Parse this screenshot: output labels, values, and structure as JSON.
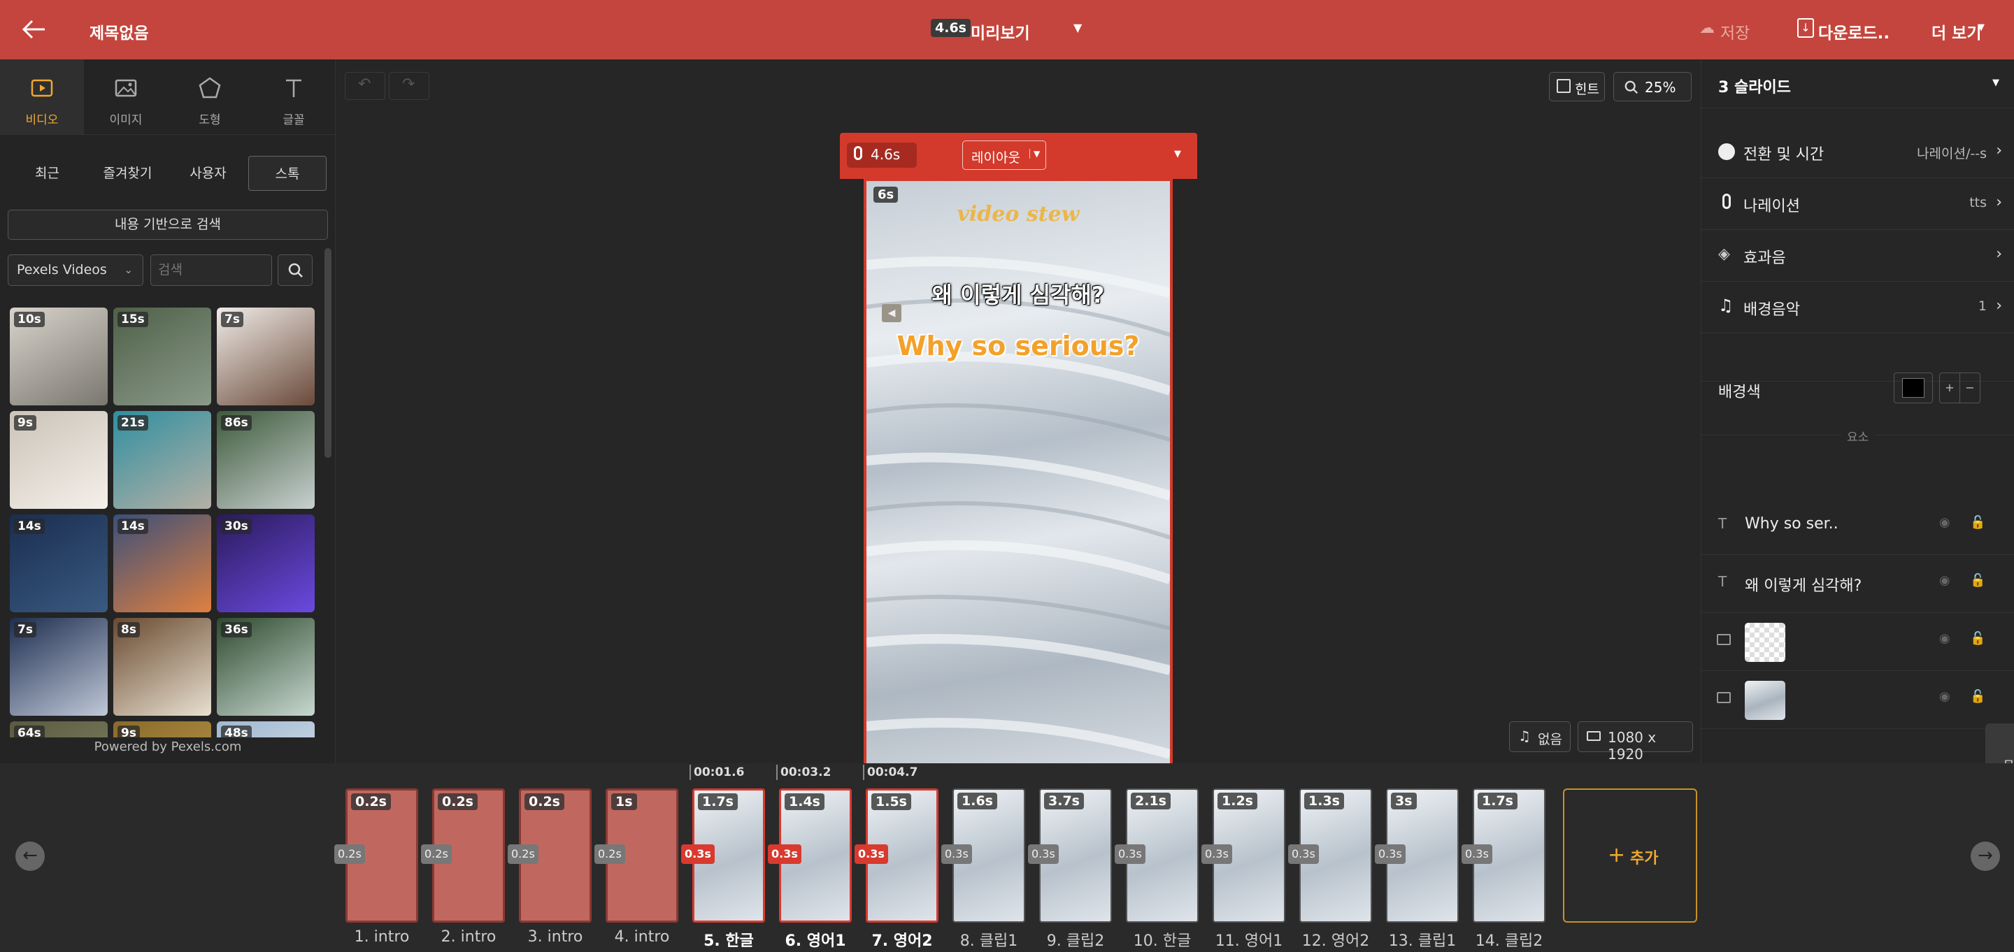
{
  "topbar": {
    "title": "제목없음",
    "preview_duration": "4.6s",
    "preview_label": "미리보기",
    "save": "저장",
    "download": "다운로드..",
    "more": "더 보기"
  },
  "media_tabs": [
    {
      "label": "비디오"
    },
    {
      "label": "이미지"
    },
    {
      "label": "도형"
    },
    {
      "label": "글꼴"
    }
  ],
  "source_tabs": [
    {
      "label": "최근"
    },
    {
      "label": "즐겨찾기"
    },
    {
      "label": "사용자"
    },
    {
      "label": "스톡"
    }
  ],
  "content_search_button": "내용 기반으로 검색",
  "provider_select": "Pexels Videos",
  "search": {
    "placeholder": "검색"
  },
  "stock_videos": [
    {
      "duration": "10s",
      "colors": [
        "#d8d4cc",
        "#7a7770"
      ]
    },
    {
      "duration": "15s",
      "colors": [
        "#4f6048",
        "#8a9a8a"
      ]
    },
    {
      "duration": "7s",
      "colors": [
        "#f0ece8",
        "#6a4a3a"
      ]
    },
    {
      "duration": "9s",
      "colors": [
        "#ccc3b8",
        "#f4f0ea"
      ]
    },
    {
      "duration": "21s",
      "colors": [
        "#2f8fa0",
        "#b5b0a5"
      ]
    },
    {
      "duration": "86s",
      "colors": [
        "#3e5a3a",
        "#c8d0d0"
      ]
    },
    {
      "duration": "14s",
      "colors": [
        "#1a2d50",
        "#3a5a80"
      ]
    },
    {
      "duration": "14s",
      "colors": [
        "#3b4f7a",
        "#e08040"
      ]
    },
    {
      "duration": "30s",
      "colors": [
        "#2a1a5a",
        "#6a4ae0"
      ]
    },
    {
      "duration": "7s",
      "colors": [
        "#1e2e50",
        "#c0c8d8"
      ]
    },
    {
      "duration": "8s",
      "colors": [
        "#6a4a30",
        "#e8e0d0"
      ]
    },
    {
      "duration": "36s",
      "colors": [
        "#2e4a2e",
        "#c8d8d0"
      ]
    },
    {
      "duration": "64s",
      "colors": [
        "#5a5a40",
        "#8a8a6a"
      ]
    },
    {
      "duration": "9s",
      "colors": [
        "#8a6a2a",
        "#c0a050"
      ]
    },
    {
      "duration": "48s",
      "colors": [
        "#a0b8d0",
        "#e0e8f0"
      ]
    }
  ],
  "powered_by": "Powered by Pexels.com",
  "canvas_toolbar": {
    "hint": "힌트",
    "zoom": "25%"
  },
  "slide_header": {
    "narration_duration": "4.6s",
    "layout_button": "레이아웃"
  },
  "canvas": {
    "timer": "6s",
    "watermark": "video stew",
    "korean_text": "왜 이렇게 심각해?",
    "english_text": "Why so serious?"
  },
  "canvas_footer": {
    "music": "없음",
    "resolution": "1080 x 1920"
  },
  "right_panel": {
    "slide_title": "3 슬라이드",
    "rows": [
      {
        "label": "전환 및 시간",
        "value": "나레이션/--s"
      },
      {
        "label": "나레이션",
        "value": "tts"
      },
      {
        "label": "효과음",
        "value": ""
      },
      {
        "label": "배경음악",
        "value": "1"
      }
    ],
    "bg_color_label": "배경색",
    "bg_color": "#000000",
    "elements_label": "요소",
    "elements": [
      {
        "type": "text",
        "label": "Why so ser.."
      },
      {
        "type": "text",
        "label": "왜 이렇게 심각해?"
      },
      {
        "type": "image",
        "label": ""
      },
      {
        "type": "video",
        "label": ""
      }
    ],
    "side_tab": "문의"
  },
  "timeline": {
    "timestamps": [
      "00:01.6",
      "00:03.2",
      "00:04.7"
    ],
    "slides": [
      {
        "name": "1. intro",
        "duration": "0.2s",
        "transition": "0.2s",
        "kind": "intro"
      },
      {
        "name": "2. intro",
        "duration": "0.2s",
        "transition": "0.2s",
        "kind": "intro"
      },
      {
        "name": "3. intro",
        "duration": "0.2s",
        "transition": "0.2s",
        "kind": "intro"
      },
      {
        "name": "4. intro",
        "duration": "1s",
        "transition": "0.2s",
        "kind": "intro"
      },
      {
        "name": "5. 한글",
        "duration": "1.7s",
        "transition": "0.3s",
        "kind": "sel"
      },
      {
        "name": "6. 영어1",
        "duration": "1.4s",
        "transition": "0.3s",
        "kind": "sel"
      },
      {
        "name": "7. 영어2",
        "duration": "1.5s",
        "transition": "0.3s",
        "kind": "sel"
      },
      {
        "name": "8. 클립1",
        "duration": "1.6s",
        "transition": "0.3s",
        "kind": "img"
      },
      {
        "name": "9. 클립2",
        "duration": "3.7s",
        "transition": "0.3s",
        "kind": "img"
      },
      {
        "name": "10. 한글",
        "duration": "2.1s",
        "transition": "0.3s",
        "kind": "img"
      },
      {
        "name": "11. 영어1",
        "duration": "1.2s",
        "transition": "0.3s",
        "kind": "img"
      },
      {
        "name": "12. 영어2",
        "duration": "1.3s",
        "transition": "0.3s",
        "kind": "img"
      },
      {
        "name": "13. 클립1",
        "duration": "3s",
        "transition": "0.3s",
        "kind": "img"
      },
      {
        "name": "14. 클립2",
        "duration": "1.7s",
        "transition": "0.3s",
        "kind": "img"
      }
    ],
    "add_label": "추가"
  }
}
